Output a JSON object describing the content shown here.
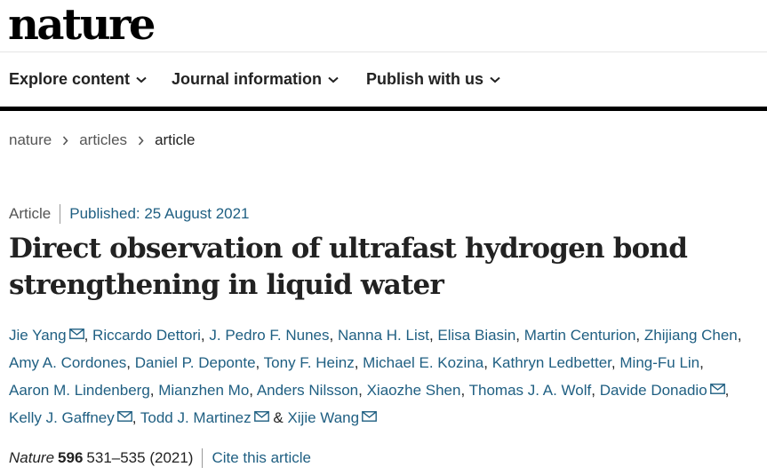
{
  "header": {
    "logo": "nature"
  },
  "nav": {
    "items": [
      "Explore content",
      "Journal information",
      "Publish with us"
    ]
  },
  "breadcrumb": [
    "nature",
    "articles",
    "article"
  ],
  "article": {
    "type": "Article",
    "published": "Published: 25 August 2021",
    "title": "Direct observation of ultrafast hydrogen bond strengthening in liquid water",
    "authors": [
      "Jie Yang",
      "Riccardo Dettori",
      "J. Pedro F. Nunes",
      "Nanna H. List",
      "Elisa Biasin",
      "Martin Centurion",
      "Zhijiang Chen",
      "Amy A. Cordones",
      "Daniel P. Deponte",
      "Tony F. Heinz",
      "Michael E. Kozina",
      "Kathryn Ledbetter",
      "Ming-Fu Lin",
      "Aaron M. Lindenberg",
      "Mianzhen Mo",
      "Anders Nilsson",
      "Xiaozhe Shen",
      "Thomas J. A. Wolf",
      "Davide Donadio",
      "Kelly J. Gaffney",
      "Todd J. Martinez",
      "Xijie Wang"
    ],
    "and_separator": "&",
    "citation": {
      "journal": "Nature",
      "volume": "596",
      "pages": "531–535",
      "year": "(2021)",
      "cite_link": "Cite this article"
    }
  },
  "colors": {
    "link": "#1f5f82",
    "text": "#222222",
    "rule": "#000000"
  },
  "icons": {
    "nav_dropdown": "chevron-down-icon",
    "breadcrumb_separator": "chevron-right-icon",
    "author_contact": "mail-icon"
  }
}
